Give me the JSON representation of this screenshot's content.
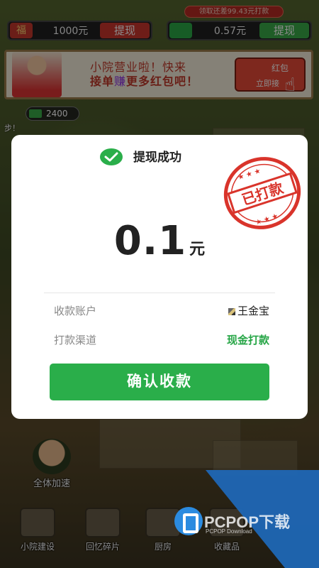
{
  "topbar": {
    "promo_text": "领取还差99.43元打款",
    "left_balance": {
      "icon_char": "福",
      "amount": "1000元",
      "button": "提现"
    },
    "right_balance": {
      "amount": "0.57元",
      "button": "提现"
    }
  },
  "banner": {
    "line1": "小院营业啦！快来",
    "line2_prefix": "接单",
    "line2_highlight": "赚",
    "line2_suffix": "更多红包吧！",
    "button_label": "红包",
    "button_sub": "立即接"
  },
  "cash_pill": {
    "value": "2400"
  },
  "step_text": "步！",
  "boost": {
    "label": "全体加速"
  },
  "nav": [
    {
      "label": "小院建设"
    },
    {
      "label": "回忆碎片"
    },
    {
      "label": "厨房"
    },
    {
      "label": "收藏品"
    }
  ],
  "watermark": {
    "text": "PCPOP下载",
    "sub": "PCPOP Download"
  },
  "modal": {
    "title": "提现成功",
    "stamp_text": "已打款",
    "amount": "0.1",
    "unit": "元",
    "rows": [
      {
        "label": "收款账户",
        "value": "王金宝"
      },
      {
        "label": "打款渠道",
        "value": "现金打款"
      }
    ],
    "confirm_label": "确认收款"
  },
  "colors": {
    "accent_green": "#2aae4a",
    "stamp_red": "#d9342b",
    "wechat_green": "#2aae4a"
  }
}
